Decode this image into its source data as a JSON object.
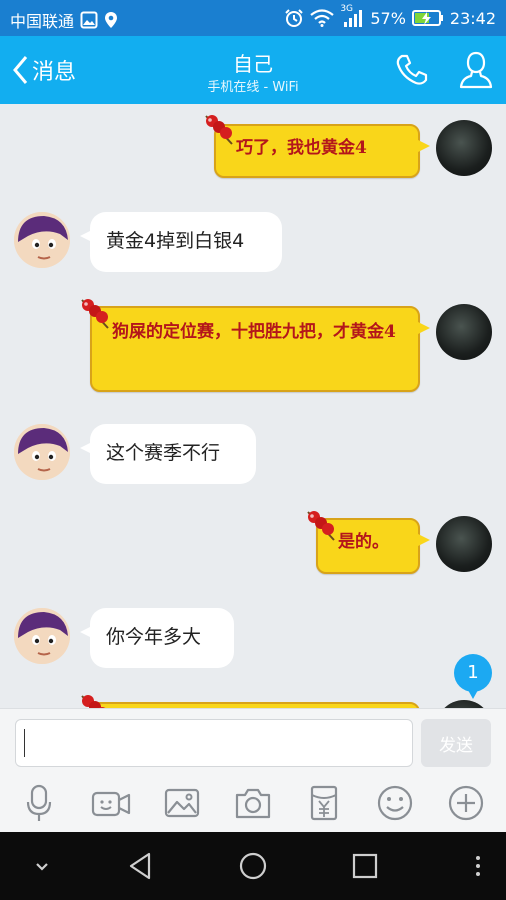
{
  "status_bar": {
    "carrier": "中国联通",
    "network": "3G",
    "battery": "57%",
    "time": "23:42"
  },
  "header": {
    "back_label": "消息",
    "title": "自己",
    "subtitle": "手机在线 - WiFi"
  },
  "messages": [
    {
      "side": "out",
      "text": "巧了，我也黄金4"
    },
    {
      "side": "in",
      "text": "黄金4掉到白银4"
    },
    {
      "side": "out",
      "text": "狗屎的定位赛，十把胜九把，才黄金4"
    },
    {
      "side": "in",
      "text": "这个赛季不行"
    },
    {
      "side": "out",
      "text": "是的。"
    },
    {
      "side": "in",
      "text": "你今年多大"
    }
  ],
  "unread_badge": "1",
  "composer": {
    "input_value": "",
    "send_label": "发送"
  },
  "toolbar_icons": [
    "microphone-icon",
    "video-icon",
    "image-icon",
    "camera-icon",
    "red-packet-icon",
    "emoji-icon",
    "plus-icon"
  ],
  "colors": {
    "status_bar": "#1a7fd0",
    "header": "#12aef0",
    "chat_background": "#e9ecef",
    "out_bubble": "#f9d61a",
    "out_text": "#b4161b",
    "badge": "#1ca9f2"
  }
}
